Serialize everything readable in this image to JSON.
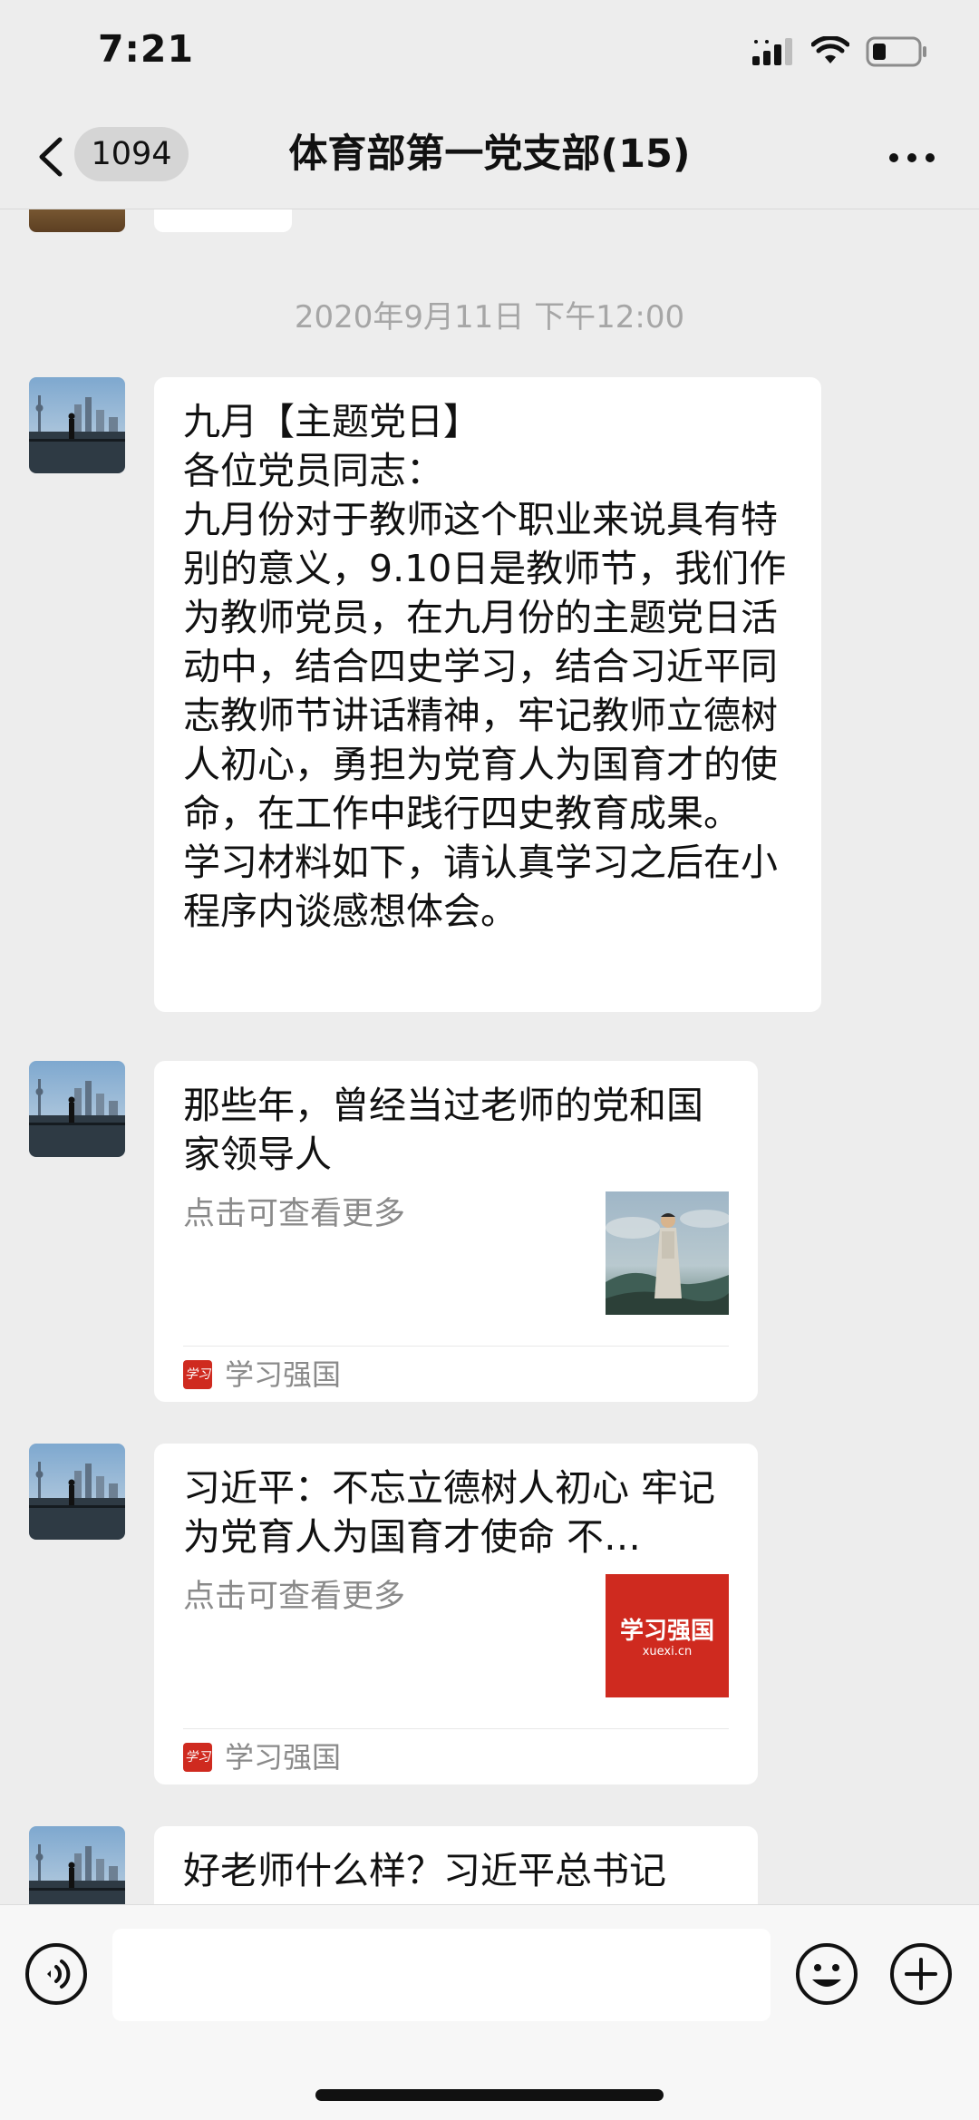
{
  "status_bar": {
    "time": "7:21"
  },
  "nav": {
    "back_count": "1094",
    "title": "体育部第一党支部(15)"
  },
  "chat": {
    "timestamp": "2020年9月11日 下午12:00",
    "messages": [
      {
        "type": "text",
        "text": "九月【主题党日】\n各位党员同志：\n九月份对于教师这个职业来说具有特别的意义，9.10日是教师节，我们作为教师党员，在九月份的主题党日活动中，结合四史学习，结合习近平同志教师节讲话精神，牢记教师立德树人初心，勇担为党育人为国育才的使命，在工作中践行四史教育成果。\n学习材料如下，请认真学习之后在小程序内谈感想体会。"
      },
      {
        "type": "card",
        "title": "那些年，曾经当过老师的党和国家领导人",
        "description": "点击可查看更多",
        "source": "学习强国",
        "source_logo_text": "学习",
        "thumbnail": "painting-thumbnail"
      },
      {
        "type": "card",
        "title": "习近平：不忘立德树人初心 牢记为党育人为国育才使命 不…",
        "description": "点击可查看更多",
        "source": "学习强国",
        "source_logo_text": "学习",
        "thumbnail": "xuexi-logo-thumbnail",
        "thumbnail_brand": "学习强国",
        "thumbnail_url": "xuexi.cn"
      },
      {
        "type": "card",
        "title": "好老师什么样？习近平总书记"
      }
    ]
  },
  "input_bar": {
    "placeholder": ""
  },
  "colors": {
    "background": "#ededed",
    "bubble": "#ffffff",
    "brand_red": "#cf2a1f",
    "timestamp": "#a6a6a6",
    "secondary_text": "#8a8a8a"
  }
}
